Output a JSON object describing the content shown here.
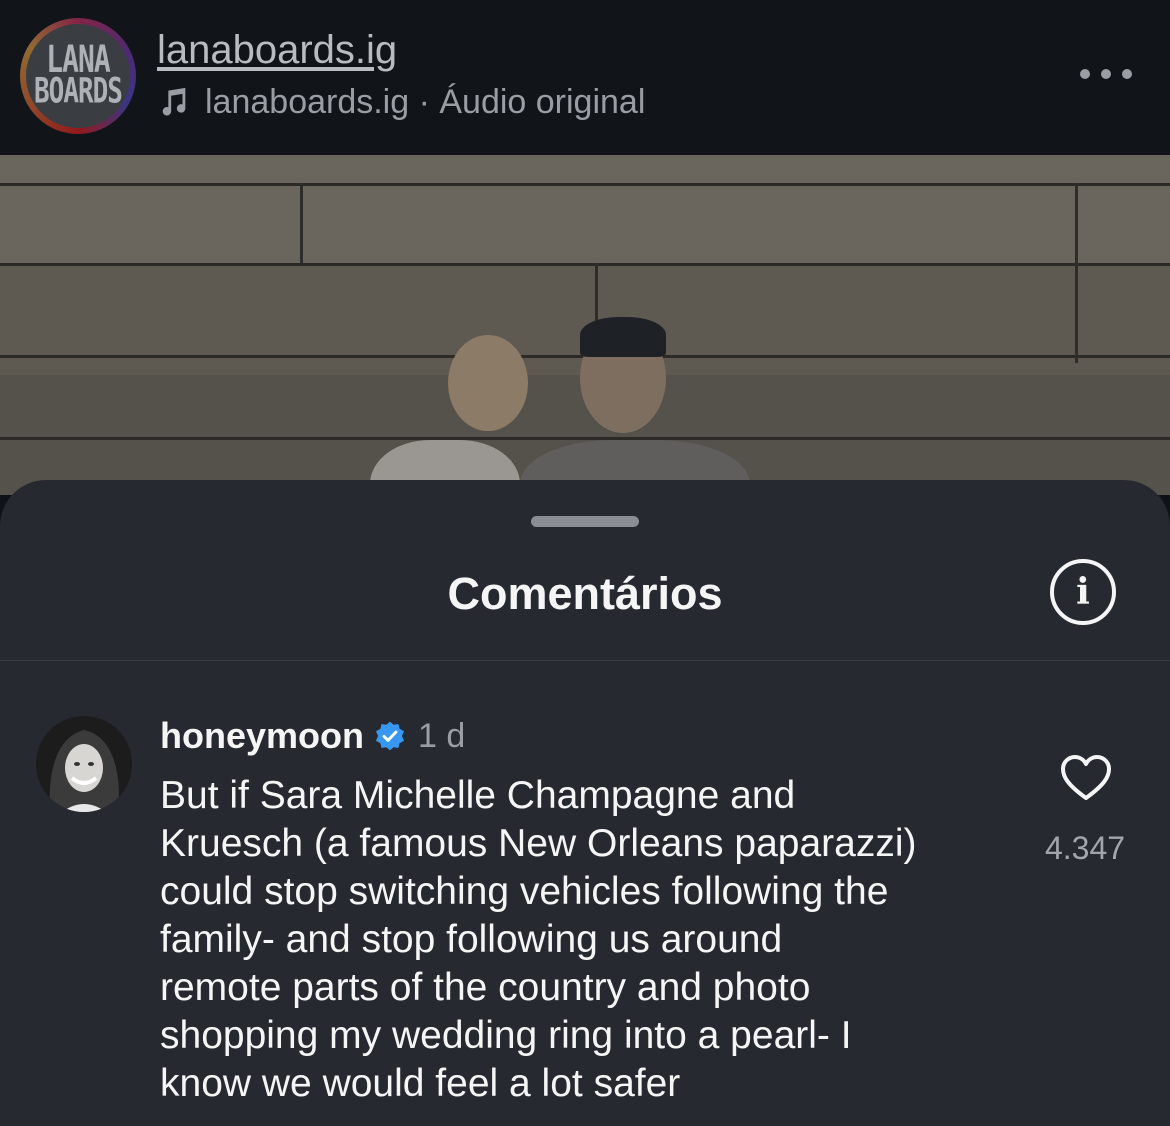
{
  "header": {
    "avatar_text_line1": "LANA",
    "avatar_text_line2": "BOARDS",
    "account_name": "lanaboards.ig",
    "audio_label": "lanaboards.ig · Áudio original",
    "music_icon": "music-note-icon",
    "more_icon": "more-dots-icon"
  },
  "comments_sheet": {
    "title": "Comentários",
    "info_icon_glyph": "i",
    "comment": {
      "username": "honeymoon",
      "verified_icon": "verified-badge-icon",
      "verified_color": "#3897f0",
      "time": "1 d",
      "text": "But if Sara Michelle Champagne and\nKruesch (a famous New Orleans paparazzi)\ncould stop switching vehicles following the\nfamily- and  stop following us around\nremote parts of the country and photo\nshopping my wedding ring into a pearl- I\nknow we would feel a lot safer",
      "like_icon": "heart-outline-icon",
      "like_count": "4.347"
    }
  }
}
